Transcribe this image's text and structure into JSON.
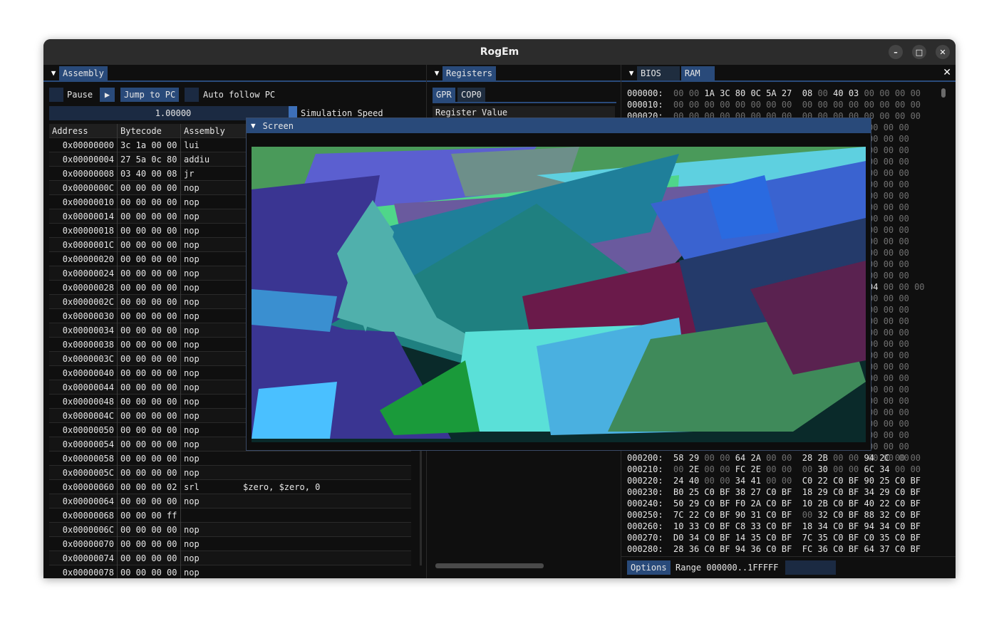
{
  "window": {
    "title": "RogEm"
  },
  "assembly": {
    "tab": "Assembly",
    "pause_label": "Pause",
    "jump_label": "Jump to PC",
    "follow_label": "Auto follow PC",
    "speed_value": "1.00000",
    "speed_label": "Simulation Speed",
    "headers": [
      "Address",
      "Bytecode",
      "Assembly"
    ],
    "rows": [
      [
        "0x00000000",
        "3c 1a 00 00",
        "lui",
        ""
      ],
      [
        "0x00000004",
        "27 5a 0c 80",
        "addiu",
        ""
      ],
      [
        "0x00000008",
        "03 40 00 08",
        "jr",
        ""
      ],
      [
        "0x0000000C",
        "00 00 00 00",
        "nop",
        ""
      ],
      [
        "0x00000010",
        "00 00 00 00",
        "nop",
        ""
      ],
      [
        "0x00000014",
        "00 00 00 00",
        "nop",
        ""
      ],
      [
        "0x00000018",
        "00 00 00 00",
        "nop",
        ""
      ],
      [
        "0x0000001C",
        "00 00 00 00",
        "nop",
        ""
      ],
      [
        "0x00000020",
        "00 00 00 00",
        "nop",
        ""
      ],
      [
        "0x00000024",
        "00 00 00 00",
        "nop",
        ""
      ],
      [
        "0x00000028",
        "00 00 00 00",
        "nop",
        ""
      ],
      [
        "0x0000002C",
        "00 00 00 00",
        "nop",
        ""
      ],
      [
        "0x00000030",
        "00 00 00 00",
        "nop",
        ""
      ],
      [
        "0x00000034",
        "00 00 00 00",
        "nop",
        ""
      ],
      [
        "0x00000038",
        "00 00 00 00",
        "nop",
        ""
      ],
      [
        "0x0000003C",
        "00 00 00 00",
        "nop",
        ""
      ],
      [
        "0x00000040",
        "00 00 00 00",
        "nop",
        ""
      ],
      [
        "0x00000044",
        "00 00 00 00",
        "nop",
        ""
      ],
      [
        "0x00000048",
        "00 00 00 00",
        "nop",
        ""
      ],
      [
        "0x0000004C",
        "00 00 00 00",
        "nop",
        ""
      ],
      [
        "0x00000050",
        "00 00 00 00",
        "nop",
        ""
      ],
      [
        "0x00000054",
        "00 00 00 00",
        "nop",
        ""
      ],
      [
        "0x00000058",
        "00 00 00 00",
        "nop",
        ""
      ],
      [
        "0x0000005C",
        "00 00 00 00",
        "nop",
        ""
      ],
      [
        "0x00000060",
        "00 00 00 02",
        "srl",
        "$zero, $zero, 0"
      ],
      [
        "0x00000064",
        "00 00 00 00",
        "nop",
        ""
      ],
      [
        "0x00000068",
        "00 00 00 ff",
        "",
        ""
      ],
      [
        "0x0000006C",
        "00 00 00 00",
        "nop",
        ""
      ],
      [
        "0x00000070",
        "00 00 00 00",
        "nop",
        ""
      ],
      [
        "0x00000074",
        "00 00 00 00",
        "nop",
        ""
      ],
      [
        "0x00000078",
        "00 00 00 00",
        "nop",
        ""
      ]
    ]
  },
  "registers": {
    "tab": "Registers",
    "subtabs": [
      "GPR",
      "COP0"
    ],
    "header_register": "Register",
    "header_value": "Value"
  },
  "memory": {
    "tabs": [
      "BIOS",
      "RAM"
    ],
    "close_icon": "x",
    "rows_top": [
      {
        "addr": "000000:",
        "bytes": [
          "00",
          "00",
          "1A",
          "3C",
          "80",
          "0C",
          "5A",
          "27",
          "08",
          "00",
          "40",
          "03",
          "00",
          "00",
          "00",
          "00"
        ]
      },
      {
        "addr": "000010:",
        "bytes": [
          "00",
          "00",
          "00",
          "00",
          "00",
          "00",
          "00",
          "00",
          "00",
          "00",
          "00",
          "00",
          "00",
          "00",
          "00",
          "00"
        ]
      },
      {
        "addr": "000020:",
        "bytes": [
          "00",
          "00",
          "00",
          "00",
          "00",
          "00",
          "00",
          "00",
          "00",
          "00",
          "00",
          "00",
          "00",
          "00",
          "00",
          "00"
        ]
      }
    ],
    "right_col": [
      "00 00 00",
      "00 00 00",
      "00 00 00",
      "00 00 00",
      "00 00 00",
      "00 00 00",
      "00 00 00",
      "00 00 00",
      "00 00 00",
      "00 00 00",
      "00 00 00",
      "00 00 00",
      "00 00 00",
      "00 00 00",
      "04 00 00 00",
      "00 00 00",
      "00 00 00",
      "00 00 00",
      "00 00 00",
      "00 00 00",
      "00 00 00",
      "00 00 00",
      "00 00 00",
      "00 00 00",
      "00 00 00",
      "00 00 00",
      "00 00 00",
      "00 00 00",
      "00 00 00",
      "00 00 00"
    ],
    "rows_bottom": [
      {
        "addr": "000200:",
        "bytes": [
          "58",
          "29",
          "00",
          "00",
          "64",
          "2A",
          "00",
          "00",
          "28",
          "2B",
          "00",
          "00",
          "94",
          "2C",
          "00",
          "00"
        ]
      },
      {
        "addr": "000210:",
        "bytes": [
          "00",
          "2E",
          "00",
          "00",
          "FC",
          "2E",
          "00",
          "00",
          "00",
          "30",
          "00",
          "00",
          "6C",
          "34",
          "00",
          "00"
        ]
      },
      {
        "addr": "000220:",
        "bytes": [
          "24",
          "40",
          "00",
          "00",
          "34",
          "41",
          "00",
          "00",
          "C0",
          "22",
          "C0",
          "BF",
          "90",
          "25",
          "C0",
          "BF"
        ]
      },
      {
        "addr": "000230:",
        "bytes": [
          "B0",
          "25",
          "C0",
          "BF",
          "38",
          "27",
          "C0",
          "BF",
          "18",
          "29",
          "C0",
          "BF",
          "34",
          "29",
          "C0",
          "BF"
        ]
      },
      {
        "addr": "000240:",
        "bytes": [
          "50",
          "29",
          "C0",
          "BF",
          "F0",
          "2A",
          "C0",
          "BF",
          "10",
          "2B",
          "C0",
          "BF",
          "40",
          "22",
          "C0",
          "BF"
        ]
      },
      {
        "addr": "000250:",
        "bytes": [
          "7C",
          "22",
          "C0",
          "BF",
          "90",
          "31",
          "C0",
          "BF",
          "00",
          "32",
          "C0",
          "BF",
          "88",
          "32",
          "C0",
          "BF"
        ]
      },
      {
        "addr": "000260:",
        "bytes": [
          "10",
          "33",
          "C0",
          "BF",
          "C8",
          "33",
          "C0",
          "BF",
          "18",
          "34",
          "C0",
          "BF",
          "94",
          "34",
          "C0",
          "BF"
        ]
      },
      {
        "addr": "000270:",
        "bytes": [
          "D0",
          "34",
          "C0",
          "BF",
          "14",
          "35",
          "C0",
          "BF",
          "7C",
          "35",
          "C0",
          "BF",
          "C0",
          "35",
          "C0",
          "BF"
        ]
      },
      {
        "addr": "000280:",
        "bytes": [
          "28",
          "36",
          "C0",
          "BF",
          "94",
          "36",
          "C0",
          "BF",
          "FC",
          "36",
          "C0",
          "BF",
          "64",
          "37",
          "C0",
          "BF"
        ]
      }
    ],
    "options_label": "Options",
    "range_label": "Range 000000..1FFFFF"
  },
  "screen": {
    "title": "Screen"
  }
}
